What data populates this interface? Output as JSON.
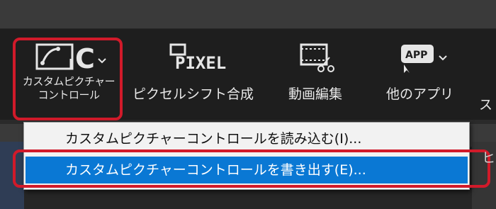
{
  "toolbar": {
    "picture_control": {
      "label_line1": "カスタムピクチャー",
      "label_line2": "コントロール",
      "icon_letter": "C"
    },
    "pixel_shift": {
      "label": "ピクセルシフト合成",
      "icon_text": "PIXEL"
    },
    "video_edit": {
      "label": "動画編集"
    },
    "other_apps": {
      "label": "他のアプリ",
      "icon_text": "APP"
    },
    "cut_item": {
      "label": "ス"
    }
  },
  "menu": {
    "items": [
      {
        "label": "カスタムピクチャーコントロールを読み込む(I)...",
        "selected": false
      },
      {
        "label": "カスタムピクチャーコントロールを書き出す(E)...",
        "selected": true
      }
    ]
  },
  "right_cut_text": "ヒ",
  "colors": {
    "highlight": "#d11a2a",
    "selection": "#0a78d4",
    "menu_bg": "#f2f2f2"
  }
}
